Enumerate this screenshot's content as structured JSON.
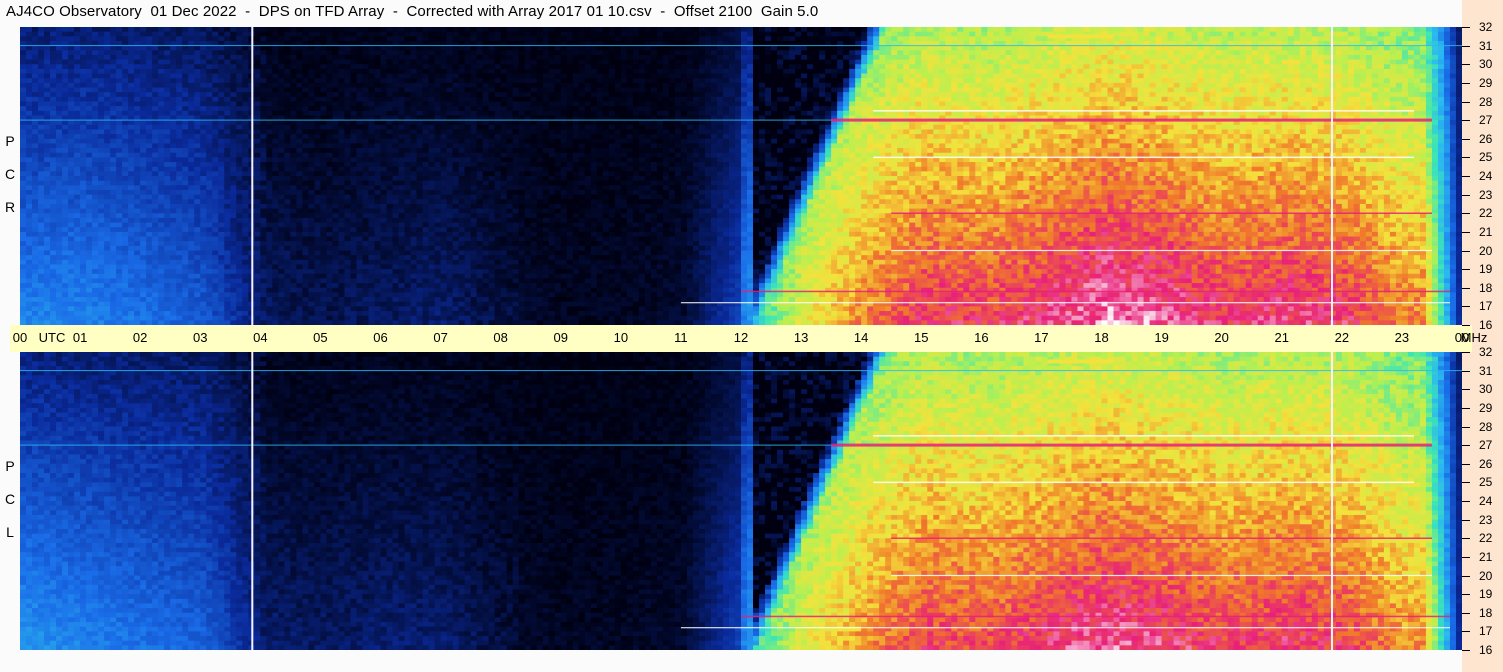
{
  "title": "AJ4CO Observatory  01 Dec 2022  -  DPS on TFD Array  -  Corrected with Array 2017 01 10.csv  -  Offset 2100  Gain 5.0",
  "panels": [
    {
      "id": "rcp",
      "label": [
        "R",
        "C",
        "P"
      ]
    },
    {
      "id": "lcp",
      "label": [
        "L",
        "C",
        "P"
      ]
    }
  ],
  "chart_data": {
    "type": "heatmap",
    "title": "AJ4CO Observatory  01 Dec 2022  -  DPS on TFD Array  -  Corrected with Array 2017 01 10.csv  -  Offset 2100  Gain 5.0",
    "x_unit": "UTC",
    "y_unit": "MHz",
    "x_tick_labels": [
      "00",
      "01",
      "02",
      "03",
      "04",
      "05",
      "06",
      "07",
      "08",
      "09",
      "10",
      "11",
      "12",
      "13",
      "14",
      "15",
      "16",
      "17",
      "18",
      "19",
      "20",
      "21",
      "22",
      "23",
      "00"
    ],
    "x_range_hours": [
      0,
      24
    ],
    "y_range_mhz": [
      16,
      32
    ],
    "y_tick_labels": [
      "32",
      "31",
      "30",
      "29",
      "28",
      "27",
      "26",
      "25",
      "24",
      "23",
      "22",
      "21",
      "20",
      "19",
      "18",
      "17",
      "16"
    ],
    "colormap": [
      "#000010",
      "#0a2a9a",
      "#1a6ce8",
      "#2bb8f0",
      "#3de6b4",
      "#b8f050",
      "#f4e23c",
      "#f07a2a",
      "#e8207a",
      "#ffffff"
    ],
    "series": [
      {
        "name": "RCP",
        "intensity_profile_by_hour": [
          0.2,
          0.2,
          0.18,
          0.15,
          0.05,
          0.04,
          0.05,
          0.06,
          0.03,
          0.02,
          0.02,
          0.03,
          0.2,
          0.45,
          0.6,
          0.7,
          0.68,
          0.72,
          0.78,
          0.75,
          0.7,
          0.72,
          0.7,
          0.6
        ]
      },
      {
        "name": "LCP",
        "intensity_profile_by_hour": [
          0.22,
          0.2,
          0.18,
          0.16,
          0.06,
          0.05,
          0.06,
          0.06,
          0.03,
          0.02,
          0.02,
          0.03,
          0.2,
          0.45,
          0.58,
          0.68,
          0.66,
          0.7,
          0.75,
          0.72,
          0.68,
          0.7,
          0.68,
          0.58
        ]
      }
    ]
  },
  "axis": {
    "utc_text": "UTC",
    "mhz_text": "MHz"
  }
}
